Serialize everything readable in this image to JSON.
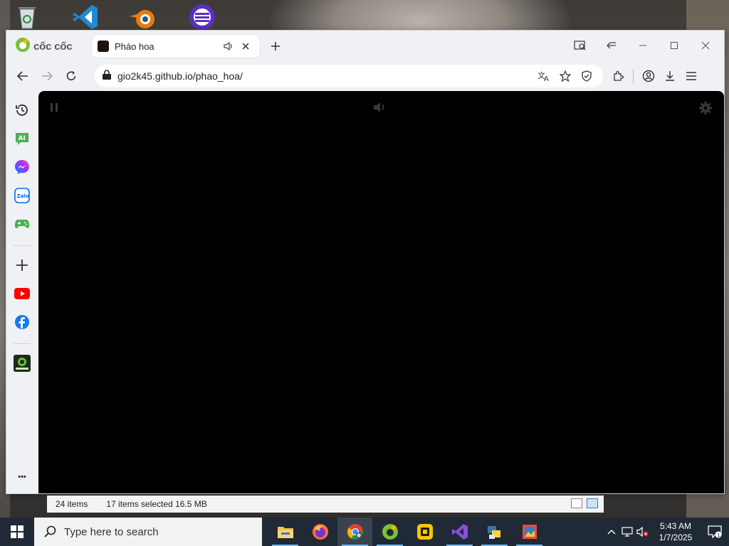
{
  "desktop": {
    "icons": [
      "recycle-bin-icon",
      "vscode-icon",
      "blender-icon",
      "eclipse-icon"
    ]
  },
  "browser": {
    "brand": "cốc cốc",
    "tab": {
      "title": "Pháo hoa"
    },
    "url": "gio2k45.github.io/phao_hoa/",
    "sidebar": [
      "history-icon",
      "ai-chat-icon",
      "messenger-icon",
      "zalo-icon",
      "games-icon",
      "add-icon",
      "youtube-icon",
      "facebook-icon",
      "coccoc-2024-icon",
      "more-icon"
    ],
    "sidebar_ai_label": "AI",
    "sidebar_more_label": "•••"
  },
  "explorer_status": {
    "items": "24 items",
    "selected": "17 items selected  16.5 MB"
  },
  "taskbar": {
    "search_placeholder": "Type here to search",
    "time": "5:43 AM",
    "date": "1/7/2025",
    "notifications": "1"
  }
}
